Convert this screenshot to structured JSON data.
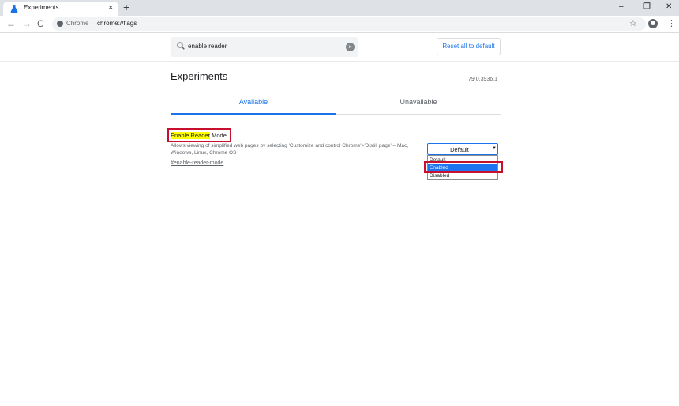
{
  "browser": {
    "tab_title": "Experiments",
    "new_tab_glyph": "+",
    "tab_close_glyph": "×",
    "window_controls": [
      "–",
      "❐",
      "✕"
    ],
    "nav": {
      "back": "←",
      "forward": "→",
      "reload": "C"
    },
    "omnibox": {
      "site_label": "Chrome",
      "url": "chrome://flags"
    },
    "toolbar_icons": {
      "star": "☆",
      "menu": "⋮"
    }
  },
  "flags_page": {
    "search": {
      "value": "enable reader",
      "clear_glyph": "×"
    },
    "reset_button": "Reset all to default",
    "title": "Experiments",
    "version": "79.0.3936.1",
    "tabs": [
      {
        "label": "Available",
        "active": true
      },
      {
        "label": "Unavailable",
        "active": false
      }
    ],
    "flag": {
      "title_highlighted": "Enable Reader",
      "title_rest": " Mode",
      "description": "Allows viewing of simplified web pages by selecting 'Customize and control Chrome'>'Distill page' – Mac, Windows, Linux, Chrome OS",
      "link": "#enable-reader-mode",
      "select": {
        "value": "Default",
        "arrow": "▼",
        "options": [
          "Default",
          "Enabled",
          "Disabled"
        ],
        "highlighted_option": "Enabled"
      }
    }
  },
  "colors": {
    "accent": "#1a73e8",
    "annotation_red": "#c8102e",
    "text_highlight": "#ffff00"
  }
}
